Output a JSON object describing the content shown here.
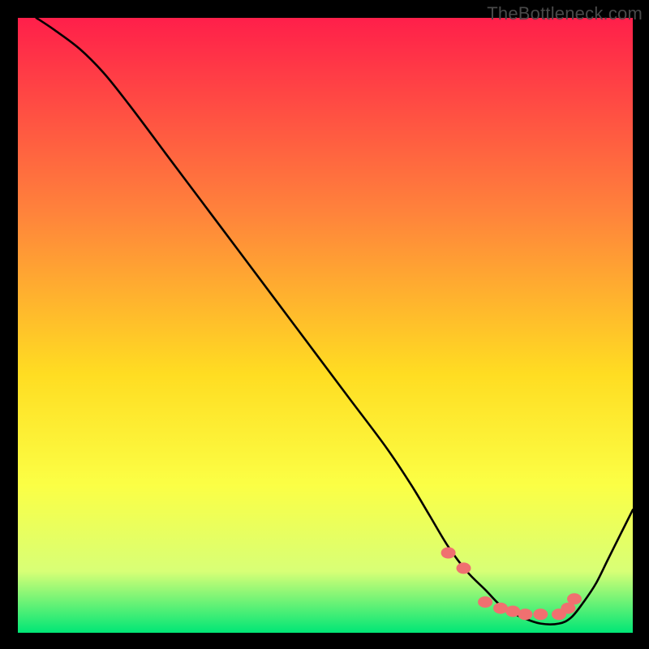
{
  "watermark": "TheBottleneck.com",
  "colors": {
    "gradient_top": "#ff1f4a",
    "gradient_mid1": "#ff843b",
    "gradient_mid2": "#ffdd22",
    "gradient_mid3": "#fbff45",
    "gradient_mid4": "#d8ff76",
    "gradient_bottom": "#00e676",
    "curve": "#000000",
    "dot_fill": "#f07070",
    "dot_stroke": "#e05a5a"
  },
  "chart_data": {
    "type": "line",
    "title": "",
    "xlabel": "",
    "ylabel": "",
    "xlim": [
      0,
      100
    ],
    "ylim": [
      0,
      100
    ],
    "curve": {
      "x": [
        3,
        6,
        10,
        14,
        18,
        24,
        30,
        36,
        42,
        48,
        54,
        60,
        64,
        67,
        70,
        73,
        76,
        79,
        82,
        85,
        88,
        90,
        92,
        94,
        96,
        98,
        100
      ],
      "y": [
        100,
        98,
        95,
        91,
        86,
        78,
        70,
        62,
        54,
        46,
        38,
        30,
        24,
        19,
        14,
        10,
        7,
        4,
        2.5,
        1.5,
        1.5,
        2.5,
        5,
        8,
        12,
        16,
        20
      ]
    },
    "dots": {
      "x": [
        70,
        72.5,
        76,
        78.5,
        80.5,
        82.5,
        85,
        88,
        89.5,
        90.5
      ],
      "y": [
        13,
        10.5,
        5,
        4,
        3.5,
        3,
        3,
        3,
        4,
        5.5
      ]
    }
  }
}
